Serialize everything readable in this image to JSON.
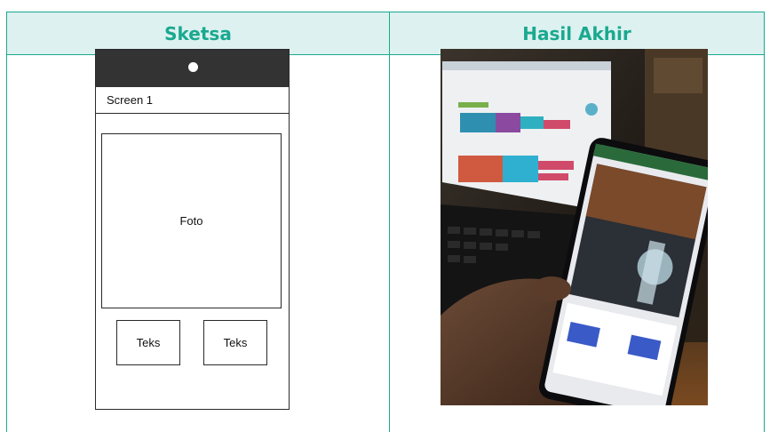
{
  "table": {
    "headers": [
      "Sketsa",
      "Hasil Akhir"
    ],
    "accent_color": "#19a98f",
    "header_bg": "#ddf1f0"
  },
  "sketch": {
    "screen_title": "Screen 1",
    "photo_label": "Foto",
    "text_box_1": "Teks",
    "text_box_2": "Teks"
  },
  "photo": {
    "description_icon": "photo-of-phone-running-app"
  }
}
